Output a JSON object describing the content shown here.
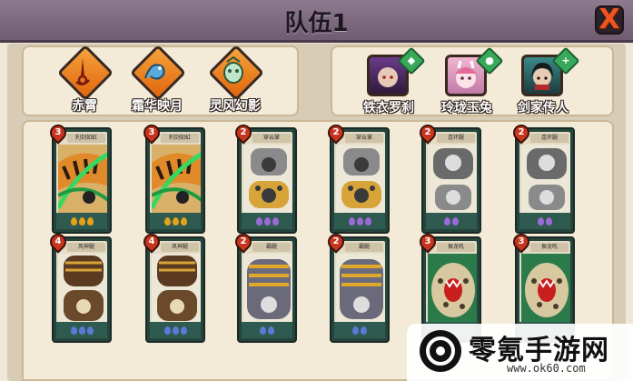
{
  "header": {
    "title": "队伍1",
    "close_label": "X"
  },
  "skills": [
    {
      "name": "赤霄",
      "icon": "sword-icon"
    },
    {
      "name": "霜华映月",
      "icon": "dragon-icon"
    },
    {
      "name": "灵风幻影",
      "icon": "spirit-icon"
    }
  ],
  "companions": [
    {
      "name": "铁衣罗刹",
      "badge_icon": "shield-icon",
      "badge_color": "#38a95a"
    },
    {
      "name": "玲珑玉兔",
      "badge_icon": "potion-icon",
      "badge_color": "#38a95a"
    },
    {
      "name": "剑家传人",
      "badge_icon": "plus-icon",
      "badge_color": "#38a95a"
    }
  ],
  "cards": [
    {
      "cost": "3",
      "name": "利剑如虹",
      "art": "tiger",
      "drops": 3,
      "drop_color": "#e3a21a"
    },
    {
      "cost": "3",
      "name": "利剑如虹",
      "art": "tiger",
      "drops": 3,
      "drop_color": "#e3a21a"
    },
    {
      "cost": "2",
      "name": "穿云掌",
      "art": "paw-gold",
      "drops": 3,
      "drop_color": "#9a6ad6"
    },
    {
      "cost": "2",
      "name": "穿云掌",
      "art": "paw-gold",
      "drops": 3,
      "drop_color": "#9a6ad6"
    },
    {
      "cost": "2",
      "name": "连环腿",
      "art": "paw-grey",
      "drops": 2,
      "drop_color": "#9a6ad6"
    },
    {
      "cost": "2",
      "name": "连环腿",
      "art": "paw-grey",
      "drops": 2,
      "drop_color": "#9a6ad6"
    },
    {
      "cost": "4",
      "name": "风神腿",
      "art": "paw-brown",
      "drops": 3,
      "drop_color": "#5a7ad8"
    },
    {
      "cost": "4",
      "name": "风神腿",
      "art": "paw-brown",
      "drops": 3,
      "drop_color": "#5a7ad8"
    },
    {
      "cost": "2",
      "name": "霸腿",
      "art": "leg-stripe",
      "drops": 2,
      "drop_color": "#5a7ad8"
    },
    {
      "cost": "2",
      "name": "霸腿",
      "art": "leg-stripe",
      "drops": 2,
      "drop_color": "#5a7ad8"
    },
    {
      "cost": "3",
      "name": "振龙吼",
      "art": "roar",
      "drops": 0,
      "drop_color": "#5a7ad8"
    },
    {
      "cost": "3",
      "name": "振龙吼",
      "art": "roar",
      "drops": 0,
      "drop_color": "#5a7ad8"
    }
  ],
  "watermark": {
    "text": "零氪手游网",
    "url": "www.ok60.com"
  }
}
